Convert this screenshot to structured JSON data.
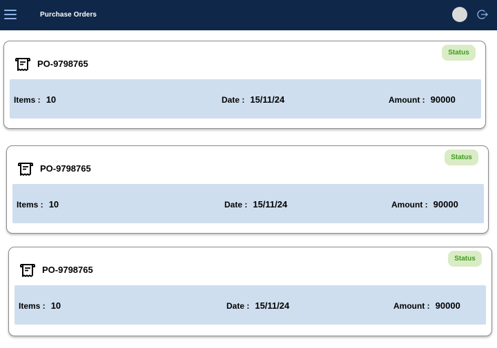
{
  "header": {
    "title": "Purchase Orders",
    "menu_icon": "hamburger-menu-icon",
    "logout_icon": "logout-icon",
    "background_color": "#0f2748"
  },
  "orders": [
    {
      "status": "Status",
      "po_number": "PO-9798765",
      "items_label": "Items :",
      "items_value": "10",
      "date_label": "Date :",
      "date_value": "15/11/24",
      "amount_label": "Amount :",
      "amount_value": "90000"
    },
    {
      "status": "Status",
      "po_number": "PO-9798765",
      "items_label": "Items :",
      "items_value": "10",
      "date_label": "Date :",
      "date_value": "15/11/24",
      "amount_label": "Amount :",
      "amount_value": "90000"
    },
    {
      "status": "Status",
      "po_number": "PO-9798765",
      "items_label": "Items :",
      "items_value": "10",
      "date_label": "Date :",
      "date_value": "15/11/24",
      "amount_label": "Amount :",
      "amount_value": "90000"
    }
  ],
  "colors": {
    "status_badge_bg": "#d9ecc5",
    "status_text": "#3f9a1f",
    "details_panel_bg": "#cedeee"
  }
}
